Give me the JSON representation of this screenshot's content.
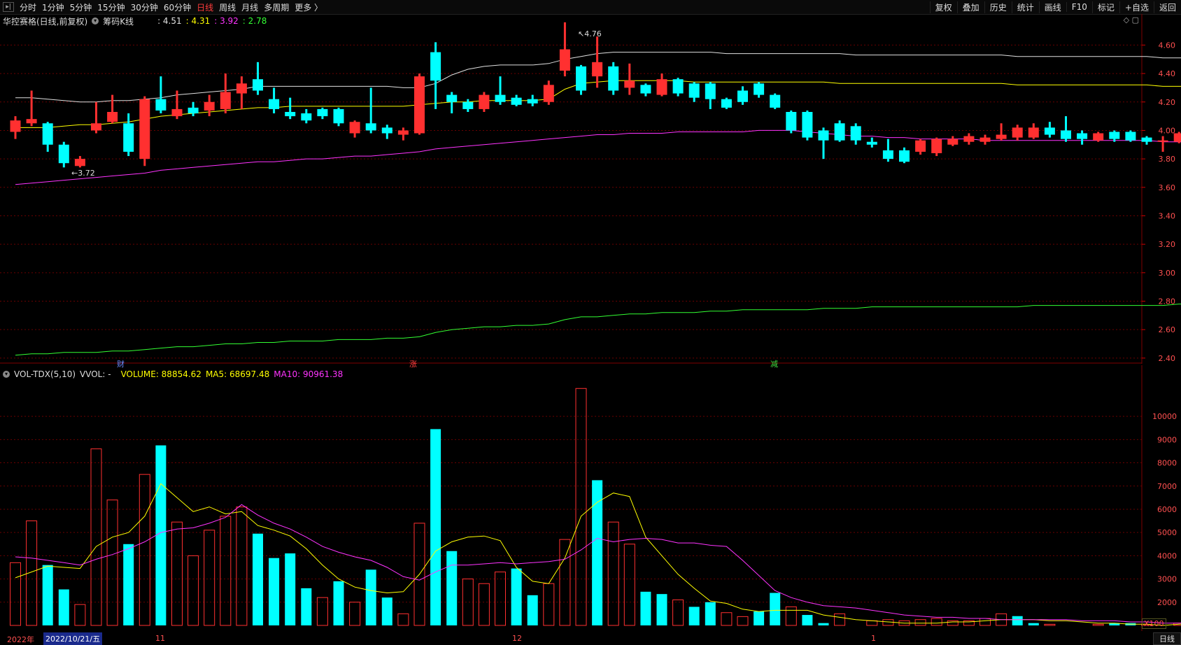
{
  "toolbar": {
    "periods": [
      "分时",
      "1分钟",
      "5分钟",
      "15分钟",
      "30分钟",
      "60分钟",
      "日线",
      "周线",
      "月线",
      "多周期",
      "更多 〉"
    ],
    "active_period": "日线",
    "right_items": [
      "复权",
      "叠加",
      "历史",
      "统计",
      "画线",
      "F10",
      "标记",
      "+自选",
      "返回"
    ]
  },
  "info": {
    "title": "华控赛格(日线,前复权)",
    "indicator": "筹码K线",
    "values": [
      {
        "text": ": 4.51",
        "color": "#e0e0e0"
      },
      {
        "text": ": 4.31",
        "color": "#ffff00"
      },
      {
        "text": ": 3.92",
        "color": "#ff33ff"
      },
      {
        "text": ": 2.78",
        "color": "#33ff33"
      }
    ]
  },
  "vol_info": {
    "name": "VOL-TDX(5,10)",
    "vvol": "VVOL: -",
    "volume": "VOLUME: 88854.62",
    "ma5": "MA5: 68697.48",
    "ma10": "MA10: 90961.38"
  },
  "annotations": {
    "cai": "财",
    "zhang": "涨",
    "jian": "减",
    "high": "4.76",
    "low": "3.72"
  },
  "date_axis": {
    "year": "2022年",
    "cursor": "2022/10/21/五",
    "months": [
      "11",
      "12",
      "1"
    ],
    "period": "日线"
  },
  "vol_unit": "X100",
  "colors": {
    "up": "#ff3030",
    "down": "#00ffff",
    "ma_white": "#e0e0e0",
    "ma_yellow": "#ffff00",
    "ma_magenta": "#ff33ff",
    "ma_green": "#33ff33",
    "grid": "#6a0000"
  },
  "chart_data": [
    {
      "type": "candlestick",
      "y_ticks": [
        2.4,
        2.6,
        2.8,
        3.0,
        3.2,
        3.4,
        3.6,
        3.8,
        4.0,
        4.2,
        4.4,
        4.6
      ],
      "ylim": [
        2.36,
        4.72
      ],
      "candles": [
        {
          "o": 3.99,
          "c": 4.07,
          "h": 4.1,
          "l": 3.94
        },
        {
          "o": 4.05,
          "c": 4.08,
          "h": 4.28,
          "l": 4.03
        },
        {
          "o": 4.05,
          "c": 3.9,
          "h": 4.06,
          "l": 3.85
        },
        {
          "o": 3.9,
          "c": 3.77,
          "h": 3.92,
          "l": 3.74
        },
        {
          "o": 3.75,
          "c": 3.8,
          "h": 3.82,
          "l": 3.74
        },
        {
          "o": 4.0,
          "c": 4.05,
          "h": 4.2,
          "l": 3.98
        },
        {
          "o": 4.06,
          "c": 4.13,
          "h": 4.25,
          "l": 4.05
        },
        {
          "o": 4.05,
          "c": 3.85,
          "h": 4.12,
          "l": 3.82
        },
        {
          "o": 3.8,
          "c": 4.22,
          "h": 4.24,
          "l": 3.75
        },
        {
          "o": 4.22,
          "c": 4.14,
          "h": 4.38,
          "l": 4.12
        },
        {
          "o": 4.1,
          "c": 4.15,
          "h": 4.28,
          "l": 4.08
        },
        {
          "o": 4.16,
          "c": 4.12,
          "h": 4.2,
          "l": 4.1
        },
        {
          "o": 4.14,
          "c": 4.2,
          "h": 4.25,
          "l": 4.1
        },
        {
          "o": 4.15,
          "c": 4.27,
          "h": 4.4,
          "l": 4.12
        },
        {
          "o": 4.26,
          "c": 4.33,
          "h": 4.38,
          "l": 4.15
        },
        {
          "o": 4.36,
          "c": 4.28,
          "h": 4.48,
          "l": 4.25
        },
        {
          "o": 4.22,
          "c": 4.15,
          "h": 4.3,
          "l": 4.12
        },
        {
          "o": 4.13,
          "c": 4.1,
          "h": 4.23,
          "l": 4.08
        },
        {
          "o": 4.12,
          "c": 4.07,
          "h": 4.15,
          "l": 4.05
        },
        {
          "o": 4.15,
          "c": 4.1,
          "h": 4.16,
          "l": 4.08
        },
        {
          "o": 4.15,
          "c": 4.05,
          "h": 4.16,
          "l": 4.03
        },
        {
          "o": 3.98,
          "c": 4.06,
          "h": 4.07,
          "l": 3.95
        },
        {
          "o": 4.05,
          "c": 4.0,
          "h": 4.3,
          "l": 3.98
        },
        {
          "o": 4.02,
          "c": 3.98,
          "h": 4.04,
          "l": 3.94
        },
        {
          "o": 3.97,
          "c": 4.0,
          "h": 4.02,
          "l": 3.93
        },
        {
          "o": 3.98,
          "c": 4.38,
          "h": 4.4,
          "l": 3.97
        },
        {
          "o": 4.55,
          "c": 4.35,
          "h": 4.62,
          "l": 4.15
        },
        {
          "o": 4.25,
          "c": 4.2,
          "h": 4.27,
          "l": 4.12
        },
        {
          "o": 4.2,
          "c": 4.15,
          "h": 4.22,
          "l": 4.13
        },
        {
          "o": 4.15,
          "c": 4.25,
          "h": 4.27,
          "l": 4.13
        },
        {
          "o": 4.25,
          "c": 4.2,
          "h": 4.38,
          "l": 4.18
        },
        {
          "o": 4.23,
          "c": 4.18,
          "h": 4.25,
          "l": 4.17
        },
        {
          "o": 4.22,
          "c": 4.19,
          "h": 4.25,
          "l": 4.17
        },
        {
          "o": 4.2,
          "c": 4.32,
          "h": 4.35,
          "l": 4.18
        },
        {
          "o": 4.42,
          "c": 4.57,
          "h": 4.76,
          "l": 4.38
        },
        {
          "o": 4.45,
          "c": 4.28,
          "h": 4.46,
          "l": 4.25
        },
        {
          "o": 4.38,
          "c": 4.48,
          "h": 4.66,
          "l": 4.3
        },
        {
          "o": 4.45,
          "c": 4.28,
          "h": 4.48,
          "l": 4.25
        },
        {
          "o": 4.3,
          "c": 4.35,
          "h": 4.47,
          "l": 4.25
        },
        {
          "o": 4.32,
          "c": 4.26,
          "h": 4.33,
          "l": 4.24
        },
        {
          "o": 4.25,
          "c": 4.36,
          "h": 4.4,
          "l": 4.24
        },
        {
          "o": 4.36,
          "c": 4.26,
          "h": 4.37,
          "l": 4.24
        },
        {
          "o": 4.33,
          "c": 4.23,
          "h": 4.34,
          "l": 4.2
        },
        {
          "o": 4.33,
          "c": 4.22,
          "h": 4.34,
          "l": 4.15
        },
        {
          "o": 4.22,
          "c": 4.16,
          "h": 4.23,
          "l": 4.15
        },
        {
          "o": 4.28,
          "c": 4.2,
          "h": 4.31,
          "l": 4.18
        },
        {
          "o": 4.33,
          "c": 4.25,
          "h": 4.34,
          "l": 4.23
        },
        {
          "o": 4.25,
          "c": 4.16,
          "h": 4.26,
          "l": 4.15
        },
        {
          "o": 4.13,
          "c": 4.0,
          "h": 4.14,
          "l": 3.98
        },
        {
          "o": 4.13,
          "c": 3.95,
          "h": 4.14,
          "l": 3.93
        },
        {
          "o": 4.0,
          "c": 3.93,
          "h": 4.02,
          "l": 3.8
        },
        {
          "o": 4.05,
          "c": 3.93,
          "h": 4.07,
          "l": 3.92
        },
        {
          "o": 4.03,
          "c": 3.93,
          "h": 4.05,
          "l": 3.9
        },
        {
          "o": 3.92,
          "c": 3.9,
          "h": 3.95,
          "l": 3.88
        },
        {
          "o": 3.86,
          "c": 3.8,
          "h": 3.94,
          "l": 3.78
        },
        {
          "o": 3.86,
          "c": 3.78,
          "h": 3.88,
          "l": 3.77
        },
        {
          "o": 3.85,
          "c": 3.93,
          "h": 3.94,
          "l": 3.83
        },
        {
          "o": 3.84,
          "c": 3.94,
          "h": 3.95,
          "l": 3.82
        },
        {
          "o": 3.9,
          "c": 3.94,
          "h": 3.96,
          "l": 3.89
        },
        {
          "o": 3.92,
          "c": 3.96,
          "h": 3.98,
          "l": 3.9
        },
        {
          "o": 3.92,
          "c": 3.95,
          "h": 3.97,
          "l": 3.9
        },
        {
          "o": 3.94,
          "c": 3.97,
          "h": 4.05,
          "l": 3.93
        },
        {
          "o": 3.95,
          "c": 4.02,
          "h": 4.04,
          "l": 3.93
        },
        {
          "o": 3.95,
          "c": 4.02,
          "h": 4.05,
          "l": 3.94
        },
        {
          "o": 4.02,
          "c": 3.97,
          "h": 4.06,
          "l": 3.95
        },
        {
          "o": 4.0,
          "c": 3.94,
          "h": 4.1,
          "l": 3.92
        },
        {
          "o": 3.98,
          "c": 3.94,
          "h": 4.0,
          "l": 3.9
        },
        {
          "o": 3.93,
          "c": 3.98,
          "h": 3.99,
          "l": 3.92
        },
        {
          "o": 3.99,
          "c": 3.94,
          "h": 4.0,
          "l": 3.92
        },
        {
          "o": 3.99,
          "c": 3.93,
          "h": 4.0,
          "l": 3.92
        },
        {
          "o": 3.95,
          "c": 3.92,
          "h": 3.96,
          "l": 3.9
        },
        {
          "o": 3.92,
          "c": 3.93,
          "h": 3.96,
          "l": 3.85
        },
        {
          "o": 3.92,
          "c": 3.98,
          "h": 3.99,
          "l": 3.91
        },
        {
          "o": 3.92,
          "c": 3.97,
          "h": 3.98,
          "l": 3.91
        }
      ],
      "ma_white": [
        4.23,
        4.23,
        4.22,
        4.21,
        4.2,
        4.2,
        4.21,
        4.21,
        4.22,
        4.23,
        4.25,
        4.26,
        4.27,
        4.28,
        4.29,
        4.31,
        4.31,
        4.31,
        4.31,
        4.31,
        4.31,
        4.31,
        4.31,
        4.31,
        4.3,
        4.3,
        4.33,
        4.39,
        4.43,
        4.45,
        4.46,
        4.46,
        4.46,
        4.47,
        4.5,
        4.52,
        4.54,
        4.55,
        4.55,
        4.55,
        4.55,
        4.55,
        4.55,
        4.55,
        4.54,
        4.54,
        4.54,
        4.54,
        4.54,
        4.54,
        4.54,
        4.54,
        4.53,
        4.53,
        4.53,
        4.53,
        4.53,
        4.53,
        4.53,
        4.53,
        4.53,
        4.53,
        4.52,
        4.52,
        4.52,
        4.52,
        4.52,
        4.52,
        4.52,
        4.52,
        4.52,
        4.51,
        4.51,
        4.51
      ],
      "ma_yellow": [
        4.02,
        4.02,
        4.02,
        4.03,
        4.04,
        4.04,
        4.05,
        4.06,
        4.08,
        4.1,
        4.11,
        4.12,
        4.13,
        4.14,
        4.15,
        4.16,
        4.16,
        4.17,
        4.17,
        4.17,
        4.17,
        4.17,
        4.17,
        4.17,
        4.17,
        4.18,
        4.19,
        4.2,
        4.2,
        4.21,
        4.21,
        4.21,
        4.21,
        4.22,
        4.29,
        4.33,
        4.34,
        4.35,
        4.35,
        4.35,
        4.35,
        4.35,
        4.34,
        4.34,
        4.34,
        4.34,
        4.34,
        4.34,
        4.34,
        4.34,
        4.34,
        4.33,
        4.33,
        4.33,
        4.33,
        4.33,
        4.33,
        4.33,
        4.33,
        4.33,
        4.33,
        4.33,
        4.32,
        4.32,
        4.32,
        4.32,
        4.32,
        4.32,
        4.32,
        4.32,
        4.32,
        4.31,
        4.31,
        4.31
      ],
      "ma_magenta": [
        3.62,
        3.63,
        3.64,
        3.65,
        3.66,
        3.67,
        3.68,
        3.69,
        3.7,
        3.72,
        3.73,
        3.74,
        3.75,
        3.76,
        3.77,
        3.78,
        3.78,
        3.79,
        3.8,
        3.8,
        3.81,
        3.82,
        3.82,
        3.83,
        3.84,
        3.85,
        3.87,
        3.88,
        3.89,
        3.9,
        3.91,
        3.92,
        3.93,
        3.94,
        3.95,
        3.96,
        3.97,
        3.97,
        3.98,
        3.98,
        3.98,
        3.99,
        3.99,
        3.99,
        3.99,
        3.99,
        4.0,
        4.0,
        4.0,
        3.99,
        3.98,
        3.97,
        3.96,
        3.96,
        3.95,
        3.95,
        3.94,
        3.94,
        3.94,
        3.94,
        3.93,
        3.93,
        3.93,
        3.93,
        3.93,
        3.93,
        3.93,
        3.93,
        3.93,
        3.93,
        3.93,
        3.92,
        3.92,
        3.92
      ],
      "ma_green": [
        2.42,
        2.43,
        2.43,
        2.44,
        2.44,
        2.44,
        2.45,
        2.45,
        2.46,
        2.47,
        2.48,
        2.48,
        2.49,
        2.5,
        2.5,
        2.51,
        2.51,
        2.52,
        2.52,
        2.52,
        2.53,
        2.53,
        2.53,
        2.54,
        2.54,
        2.55,
        2.58,
        2.6,
        2.61,
        2.62,
        2.62,
        2.63,
        2.63,
        2.64,
        2.67,
        2.69,
        2.69,
        2.7,
        2.71,
        2.71,
        2.72,
        2.72,
        2.72,
        2.73,
        2.73,
        2.74,
        2.74,
        2.74,
        2.74,
        2.74,
        2.75,
        2.75,
        2.75,
        2.76,
        2.76,
        2.76,
        2.76,
        2.76,
        2.76,
        2.76,
        2.76,
        2.76,
        2.76,
        2.77,
        2.77,
        2.77,
        2.77,
        2.77,
        2.77,
        2.77,
        2.77,
        2.77,
        2.78,
        2.78
      ]
    },
    {
      "type": "bar",
      "y_ticks": [
        2000,
        3000,
        4000,
        5000,
        6000,
        7000,
        8000,
        9000,
        10000
      ],
      "ylim": [
        1000,
        11600
      ],
      "volumes": [
        3700,
        5500,
        3600,
        2550,
        1900,
        8600,
        6400,
        4500,
        7500,
        8750,
        5450,
        4000,
        5100,
        5700,
        6100,
        4950,
        3900,
        4100,
        2600,
        2200,
        2900,
        2000,
        3400,
        2200,
        1500,
        5400,
        9450,
        4200,
        3000,
        2800,
        3300,
        3450,
        2300,
        2800,
        4700,
        11200,
        7250,
        5450,
        4500,
        2450,
        2350,
        2100,
        1800,
        2000,
        1550,
        1380,
        1600,
        2400,
        1800,
        1450,
        1100,
        1500,
        750,
        1200,
        1250,
        1200,
        1250,
        1300,
        1200,
        1200,
        1300,
        1500,
        1400,
        1100,
        1050,
        1000,
        950,
        1050,
        1100,
        1100,
        1050,
        950,
        1100,
        1100
      ],
      "up": [
        true,
        true,
        false,
        false,
        true,
        true,
        true,
        false,
        true,
        false,
        true,
        true,
        true,
        true,
        true,
        false,
        false,
        false,
        false,
        true,
        false,
        true,
        false,
        false,
        true,
        true,
        false,
        false,
        true,
        true,
        true,
        false,
        false,
        true,
        true,
        true,
        false,
        true,
        true,
        false,
        false,
        true,
        false,
        false,
        true,
        true,
        false,
        false,
        true,
        false,
        false,
        true,
        false,
        true,
        true,
        true,
        true,
        true,
        true,
        true,
        true,
        true,
        false,
        false,
        true,
        true,
        true,
        true,
        false,
        false,
        true,
        true,
        true,
        true
      ],
      "ma5": [
        3050,
        3300,
        3550,
        3500,
        3450,
        4400,
        4800,
        5000,
        5700,
        7100,
        6500,
        5900,
        6100,
        5800,
        5900,
        5300,
        5100,
        4850,
        4300,
        3600,
        3000,
        2650,
        2500,
        2400,
        2450,
        3200,
        4200,
        4600,
        4800,
        4850,
        4650,
        3500,
        2900,
        2800,
        3900,
        5700,
        6300,
        6700,
        6550,
        4800,
        4000,
        3200,
        2600,
        2050,
        1950,
        1700,
        1600,
        1650,
        1650,
        1650,
        1450,
        1350,
        1250,
        1200,
        1150,
        1100,
        1100,
        1100,
        1150,
        1150,
        1200,
        1250,
        1250,
        1250,
        1200,
        1200,
        1150,
        1100,
        1100,
        1050,
        1050,
        1000,
        1050,
        1100
      ],
      "ma10": [
        3950,
        3900,
        3800,
        3700,
        3600,
        3850,
        4050,
        4300,
        4600,
        5000,
        5150,
        5200,
        5400,
        5650,
        6200,
        5750,
        5400,
        5150,
        4800,
        4400,
        4150,
        3950,
        3800,
        3500,
        3100,
        2950,
        3300,
        3600,
        3600,
        3650,
        3700,
        3650,
        3700,
        3750,
        3850,
        4250,
        4750,
        4600,
        4700,
        4750,
        4700,
        4550,
        4550,
        4450,
        4400,
        3800,
        3150,
        2500,
        2200,
        2000,
        1850,
        1800,
        1750,
        1650,
        1550,
        1450,
        1400,
        1350,
        1350,
        1300,
        1300,
        1250,
        1250,
        1250,
        1250,
        1250,
        1200,
        1200,
        1200,
        1150,
        1150,
        1100,
        1100,
        1100
      ]
    }
  ]
}
